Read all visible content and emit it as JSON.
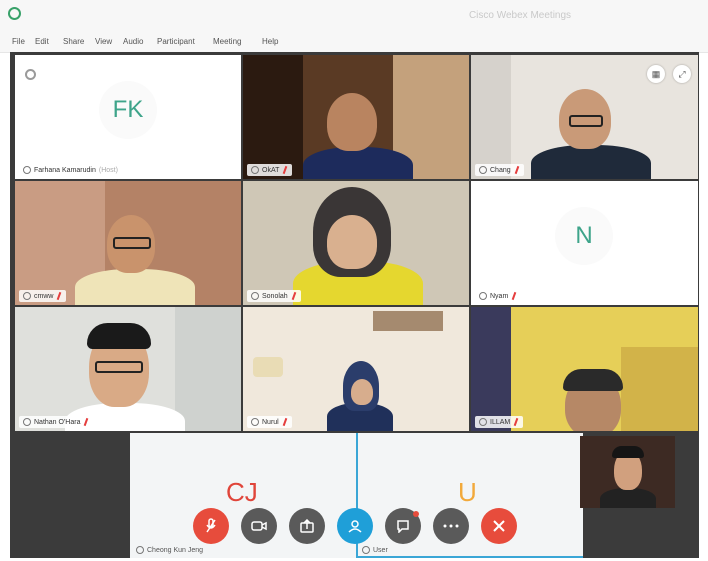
{
  "window": {
    "title": "Cisco Webex Meetings"
  },
  "menu": {
    "items": [
      "File",
      "Edit",
      "Share",
      "View",
      "Audio",
      "Participant",
      "Meeting",
      "Help"
    ]
  },
  "participants": {
    "fk": {
      "initials": "FK",
      "name": "Farhana Kamarudin",
      "role": "(Host)"
    },
    "okat": {
      "name": "OkAT"
    },
    "chang": {
      "name": "Chang"
    },
    "cmww": {
      "name": "cmww"
    },
    "sonolah": {
      "name": "Sonolah"
    },
    "n": {
      "initials": "N",
      "name": "Nyam"
    },
    "nathan": {
      "name": "Nathan O'Hara"
    },
    "nurul": {
      "name": "Nurul"
    },
    "illam": {
      "name": "ILLAM"
    },
    "cj": {
      "initials": "CJ",
      "name": "Cheong Kun Jeng"
    },
    "u": {
      "initials": "U",
      "name": "User"
    }
  },
  "controls": [
    {
      "name": "mute",
      "icon": "mic-off-icon",
      "color": "#e74c3c"
    },
    {
      "name": "video",
      "icon": "video-icon",
      "color": "#5a5a5a"
    },
    {
      "name": "share",
      "icon": "share-icon",
      "color": "#5a5a5a"
    },
    {
      "name": "participants",
      "icon": "participants-icon",
      "color": "#1f9fd8"
    },
    {
      "name": "chat",
      "icon": "chat-icon",
      "color": "#5a5a5a"
    },
    {
      "name": "more",
      "icon": "more-icon",
      "color": "#5a5a5a"
    },
    {
      "name": "leave",
      "icon": "close-icon",
      "color": "#e74c3c"
    }
  ],
  "colors": {
    "initials_green": "#3ea48a",
    "initials_red": "#e0453a",
    "initials_orange": "#f2a93b",
    "accent_blue": "#3aa6d6"
  }
}
